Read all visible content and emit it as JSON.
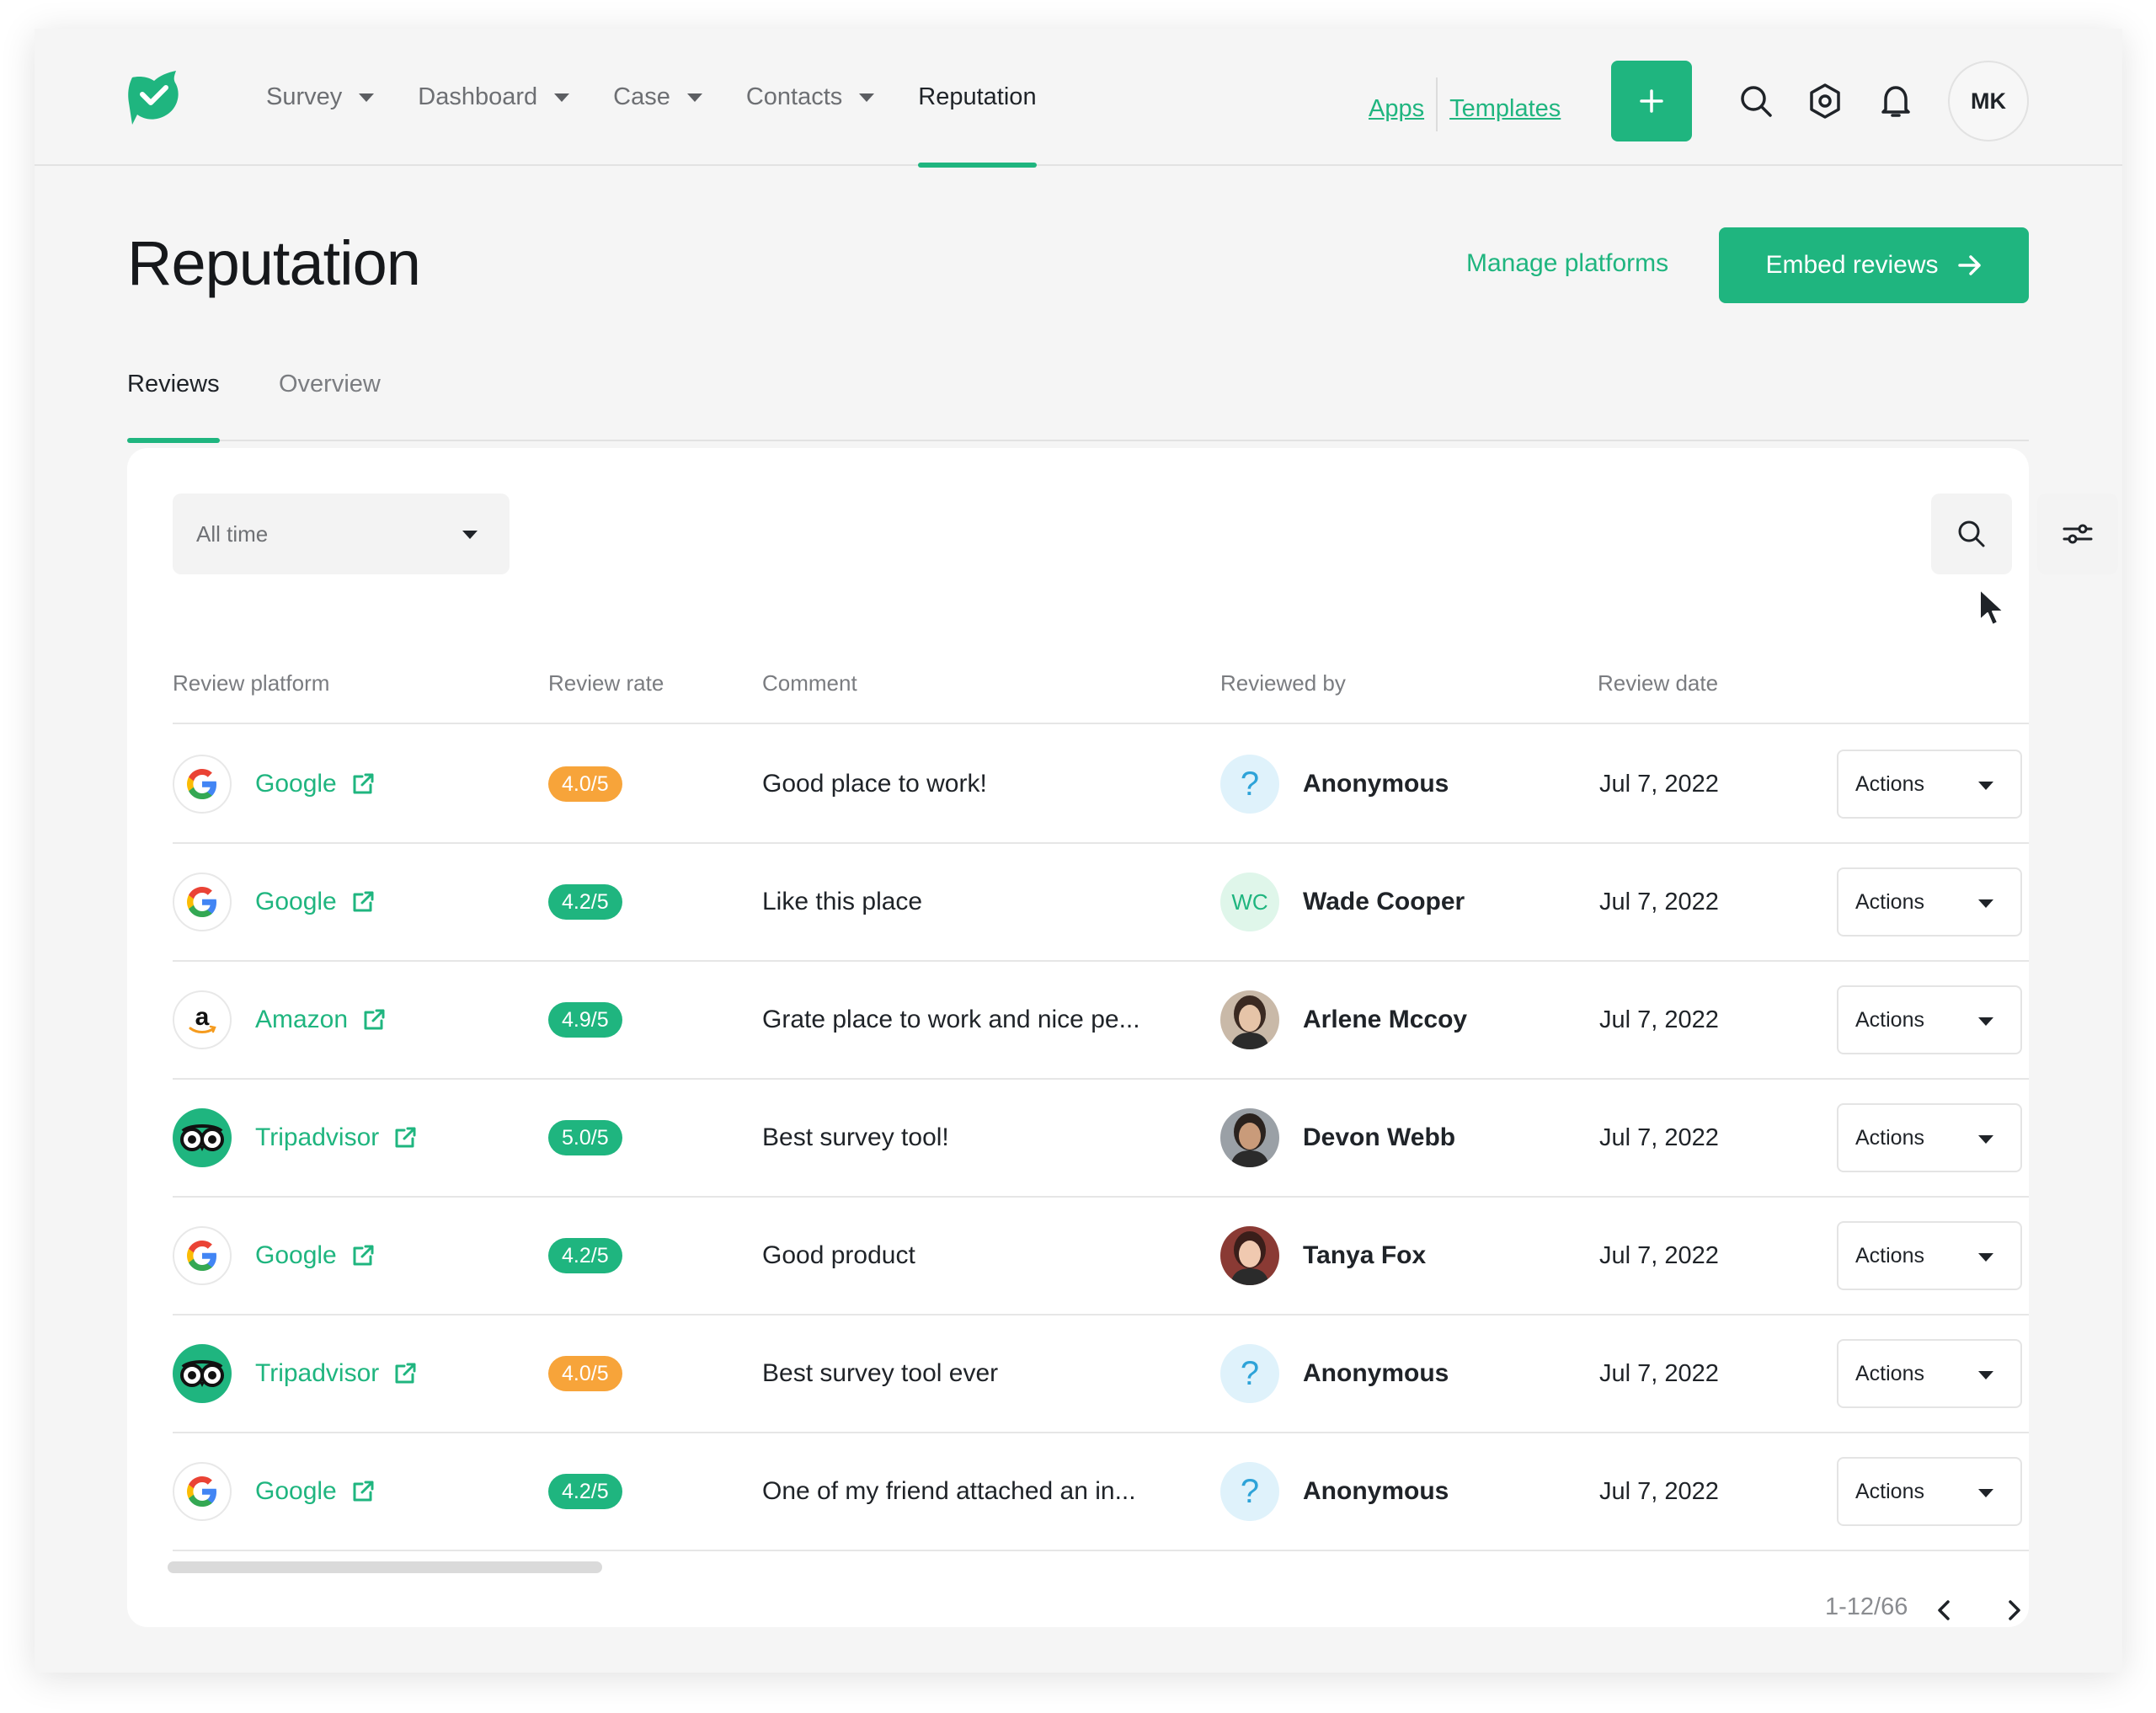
{
  "nav": {
    "items": [
      {
        "label": "Survey",
        "dropdown": true
      },
      {
        "label": "Dashboard",
        "dropdown": true
      },
      {
        "label": "Case",
        "dropdown": true
      },
      {
        "label": "Contacts",
        "dropdown": true
      },
      {
        "label": "Reputation",
        "dropdown": false,
        "active": true
      }
    ],
    "apps_link": "Apps",
    "templates_link": "Templates",
    "icons": [
      "plus-icon",
      "search-icon",
      "settings-hexagon-icon",
      "bell-icon"
    ],
    "user_initials": "MK"
  },
  "page": {
    "title": "Reputation",
    "manage_platforms": "Manage platforms",
    "embed_reviews": "Embed reviews",
    "tabs": [
      {
        "label": "Reviews",
        "active": true
      },
      {
        "label": "Overview",
        "active": false
      }
    ]
  },
  "filters": {
    "time_range": "All time"
  },
  "table": {
    "columns": [
      "Review platform",
      "Review rate",
      "Comment",
      "Reviewed by",
      "Review date"
    ],
    "action_label": "Actions",
    "rows": [
      {
        "platform": "Google",
        "platform_icon": "google-logo",
        "rate": "4.0/5",
        "rate_color": "#f7a43a",
        "comment": "Good place to work!",
        "reviewer": "Anonymous",
        "reviewer_type": "anonymous",
        "date": "Jul 7, 2022"
      },
      {
        "platform": "Google",
        "platform_icon": "google-logo",
        "rate": "4.2/5",
        "rate_color": "#1fb57f",
        "comment": "Like this place",
        "reviewer": "Wade Cooper",
        "reviewer_type": "initials",
        "reviewer_initials": "WC",
        "date": "Jul 7, 2022"
      },
      {
        "platform": "Amazon",
        "platform_icon": "amazon-logo",
        "rate": "4.9/5",
        "rate_color": "#1fb57f",
        "comment": "Grate place to work and nice pe...",
        "reviewer": "Arlene Mccoy",
        "reviewer_type": "photo",
        "date": "Jul 7, 2022"
      },
      {
        "platform": "Tripadvisor",
        "platform_icon": "tripadvisor-logo",
        "rate": "5.0/5",
        "rate_color": "#1fb57f",
        "comment": "Best survey tool!",
        "reviewer": "Devon Webb",
        "reviewer_type": "photo",
        "date": "Jul 7, 2022"
      },
      {
        "platform": "Google",
        "platform_icon": "google-logo",
        "rate": "4.2/5",
        "rate_color": "#1fb57f",
        "comment": "Good product",
        "reviewer": "Tanya Fox",
        "reviewer_type": "photo",
        "date": "Jul 7, 2022"
      },
      {
        "platform": "Tripadvisor",
        "platform_icon": "tripadvisor-logo",
        "rate": "4.0/5",
        "rate_color": "#f7a43a",
        "comment": "Best survey tool ever",
        "reviewer": "Anonymous",
        "reviewer_type": "anonymous",
        "date": "Jul 7, 2022"
      },
      {
        "platform": "Google",
        "platform_icon": "google-logo",
        "rate": "4.2/5",
        "rate_color": "#1fb57f",
        "comment": "One of my friend attached an in...",
        "reviewer": "Anonymous",
        "reviewer_type": "anonymous",
        "date": "Jul 7, 2022"
      }
    ]
  },
  "pagination": {
    "range": "1-12/66"
  },
  "colors": {
    "accent": "#1fb57f",
    "warning": "#f7a43a"
  }
}
